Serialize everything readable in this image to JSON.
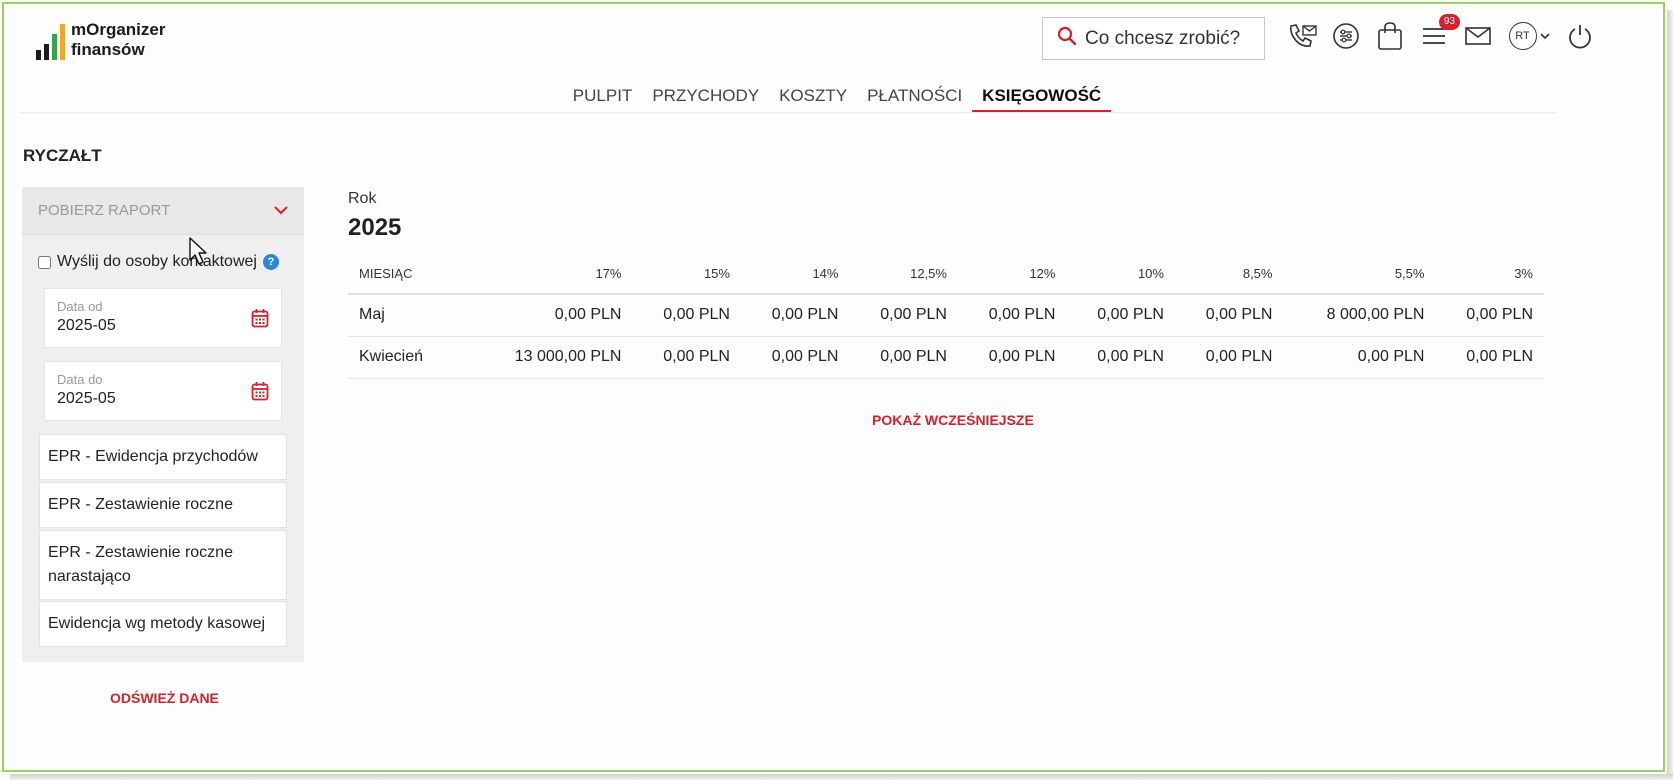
{
  "app": {
    "logo_line1": "mOrganizer",
    "logo_line2": "finansów",
    "logo_bar_colors": [
      "#1b1b1b",
      "#1b1b1b",
      "#2fa84f",
      "#f5a623"
    ]
  },
  "header": {
    "search_placeholder": "Co chcesz zrobić?",
    "notifications_count": "93",
    "user_initials": "RT",
    "icons": [
      "phone-icon",
      "settings-icon",
      "shopping-bag-icon",
      "task-list-icon",
      "mail-icon",
      "avatar",
      "chevron-down-icon",
      "power-icon"
    ]
  },
  "nav": {
    "items": [
      {
        "label": "PULPIT"
      },
      {
        "label": "PRZYCHODY"
      },
      {
        "label": "KOSZTY"
      },
      {
        "label": "PŁATNOŚCI"
      },
      {
        "label": "KSIĘGOWOŚĆ",
        "active": true
      }
    ]
  },
  "page": {
    "title": "RYCZAŁT"
  },
  "sidebar": {
    "report_header": "POBIERZ RAPORT",
    "send_to_contact": "Wyślij do osoby kontaktowej",
    "date_from_label": "Data od",
    "date_from_value": "2025-05",
    "date_to_label": "Data do",
    "date_to_value": "2025-05",
    "reports": [
      "EPR - Ewidencja przychodów",
      "EPR - Zestawienie roczne",
      "EPR - Zestawienie roczne narastająco",
      "Ewidencja wg metody kasowej"
    ],
    "refresh_label": "ODŚWIEŻ DANE"
  },
  "main": {
    "year_label": "Rok",
    "year_value": "2025",
    "table": {
      "headers": [
        "MIESIĄC",
        "17%",
        "15%",
        "14%",
        "12,5%",
        "12%",
        "10%",
        "8,5%",
        "5,5%",
        "3%"
      ],
      "rows": [
        [
          "Maj",
          "0,00 PLN",
          "0,00 PLN",
          "0,00 PLN",
          "0,00 PLN",
          "0,00 PLN",
          "0,00 PLN",
          "0,00 PLN",
          "8 000,00 PLN",
          "0,00 PLN"
        ],
        [
          "Kwiecień",
          "13 000,00 PLN",
          "0,00 PLN",
          "0,00 PLN",
          "0,00 PLN",
          "0,00 PLN",
          "0,00 PLN",
          "0,00 PLN",
          "0,00 PLN",
          "0,00 PLN"
        ]
      ]
    },
    "show_earlier": "POKAŻ WCZEŚNIEJSZE"
  },
  "colors": {
    "accent": "#d8202a",
    "frame": "#9ad35a",
    "help": "#2a87d9"
  }
}
